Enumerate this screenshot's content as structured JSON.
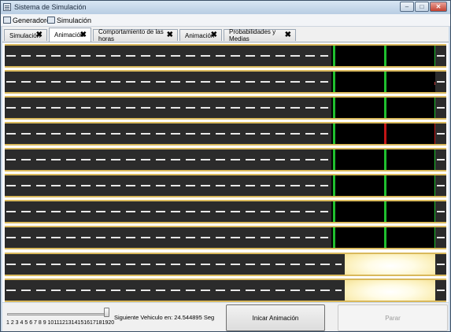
{
  "window": {
    "title": "Sistema de Simulación",
    "controls": {
      "minimize": "–",
      "maximize": "□",
      "close": "✕"
    }
  },
  "menu": {
    "items": [
      {
        "label": "Generadores",
        "icon": "table-icon"
      },
      {
        "label": "Simulación",
        "icon": "monitor-icon"
      }
    ]
  },
  "tabs": [
    {
      "label": "Simulación",
      "active": false
    },
    {
      "label": "Animación",
      "active": true
    },
    {
      "label": "Comportamiento de las horas",
      "active": false
    },
    {
      "label": "Animación",
      "active": false
    },
    {
      "label": "Probabilidades y Medias",
      "active": false
    }
  ],
  "tab_close_glyph": "✖",
  "lanes": [
    {
      "type": "signal",
      "signals": [
        "green",
        "green",
        "green"
      ],
      "car": false
    },
    {
      "type": "signal",
      "signals": [
        "green",
        "green",
        "none"
      ],
      "car": true
    },
    {
      "type": "signal",
      "signals": [
        "green",
        "green",
        "green"
      ],
      "car": false
    },
    {
      "type": "signal",
      "signals": [
        "green",
        "red",
        "red"
      ],
      "car": false
    },
    {
      "type": "signal",
      "signals": [
        "green",
        "green",
        "green"
      ],
      "car": false
    },
    {
      "type": "signal",
      "signals": [
        "green",
        "green",
        "green"
      ],
      "car": false
    },
    {
      "type": "signal",
      "signals": [
        "green",
        "green",
        "green"
      ],
      "car": false
    },
    {
      "type": "signal",
      "signals": [
        "green",
        "green",
        "green"
      ],
      "car": false
    },
    {
      "type": "glow"
    },
    {
      "type": "glow"
    }
  ],
  "colors": {
    "road": "#2b2b2b",
    "lane_border": "#d9b95c",
    "signal_green": "#1fbf2e",
    "signal_red": "#c21515",
    "glow": "#fbefb8"
  },
  "controls": {
    "slider_ticks": "1 2 3 4 5 6 7 8 9 1011121314151617181920",
    "slider_value": 20,
    "slider_min": 1,
    "slider_max": 20,
    "next_vehicle_label": "Siguiente Vehiculo en: 24.544895 Seg",
    "start_button": "Inicar Animación",
    "stop_button": "Parar"
  }
}
